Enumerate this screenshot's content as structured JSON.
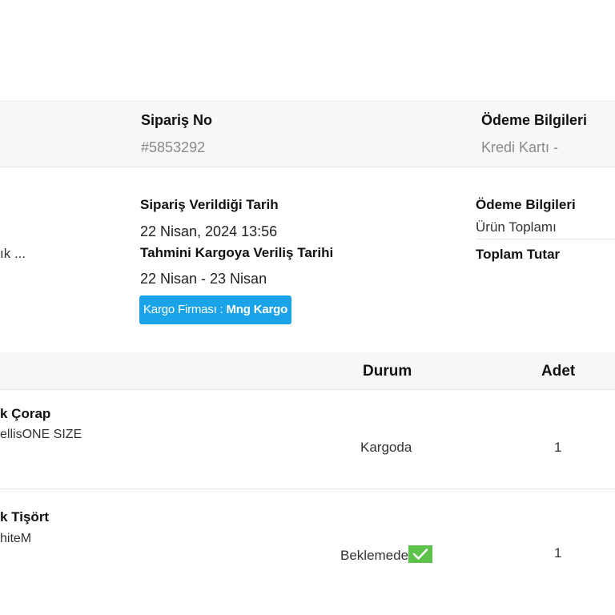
{
  "header_bar": {
    "order_no_title": "Sipariş No",
    "order_no_value": "#5853292",
    "payment_title": "Ödeme Bilgileri",
    "payment_value": "Kredi Kartı -"
  },
  "details": {
    "truncated_text": "ık ...",
    "order_date_label": "Sipariş Verildiği Tarih",
    "order_date_value": "22 Nisan, 2024 13:56",
    "ship_date_label": "Tahmini Kargoya Veriliş Tarihi",
    "ship_date_value": "22 Nisan - 23 Nisan",
    "cargo_label": "Kargo Firması : ",
    "cargo_company": "Mng Kargo",
    "payment_info_title": "Ödeme Bilgileri",
    "product_total_label": "Ürün Toplamı",
    "total_amount_label": "Toplam Tutar"
  },
  "table": {
    "headers": {
      "status": "Durum",
      "quantity": "Adet"
    },
    "rows": [
      {
        "name": "k Çorap",
        "variant": "ellisONE SIZE",
        "status": "Kargoda",
        "quantity": "1"
      },
      {
        "name": "k Tişört",
        "variant": "hiteM",
        "status": "Beklemede",
        "quantity": "1",
        "status_icon": "check-icon"
      }
    ]
  },
  "colors": {
    "badge_bg": "#1aa3e8",
    "check_green": "#5dc24a",
    "bar_bg": "#f8f8f8"
  }
}
